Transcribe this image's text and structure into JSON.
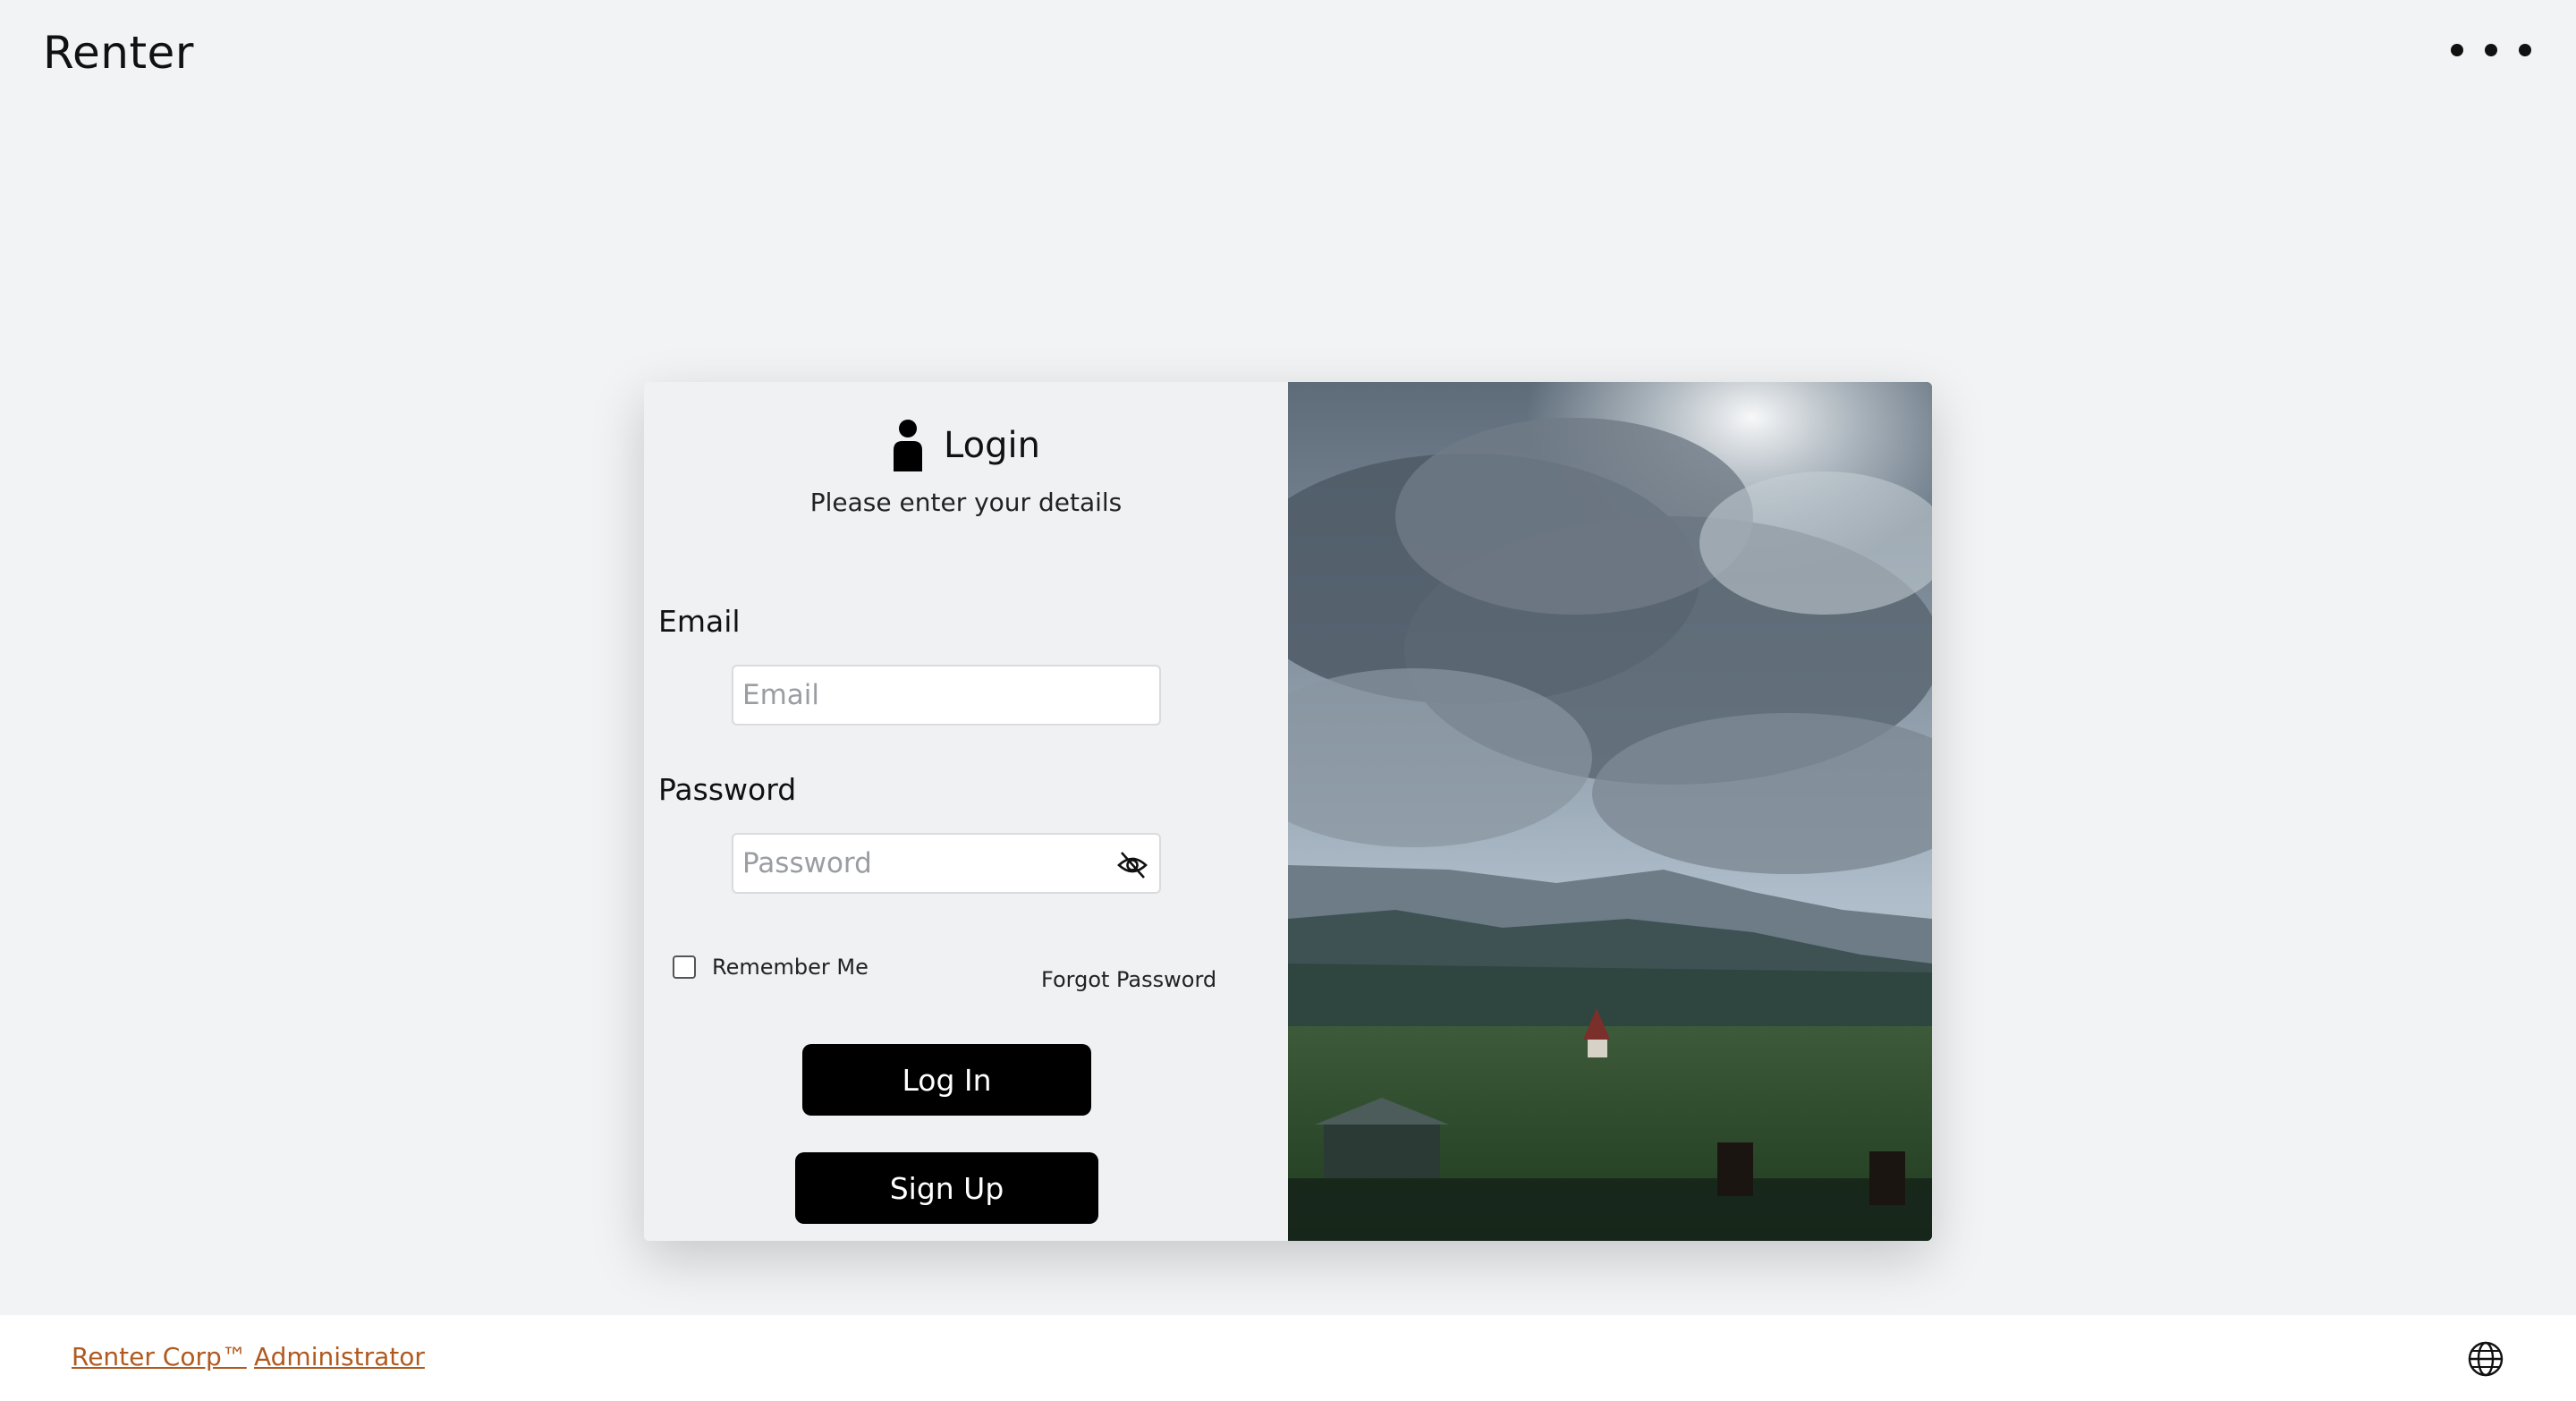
{
  "header": {
    "app_title": "Renter",
    "more_icon": "more-horizontal-icon"
  },
  "login": {
    "title": "Login",
    "subtitle": "Please enter your details",
    "user_icon": "user-icon",
    "email": {
      "label": "Email",
      "placeholder": "Email",
      "value": ""
    },
    "password": {
      "label": "Password",
      "placeholder": "Password",
      "value": "",
      "toggle_icon": "eye-off-icon"
    },
    "remember_label": "Remember Me",
    "remember_checked": false,
    "forgot_label": "Forgot Password",
    "login_button": "Log In",
    "signup_button": "Sign Up"
  },
  "image_panel": {
    "description_icon": "landscape-photo"
  },
  "footer": {
    "links": [
      "Renter Corp™",
      "Administrator"
    ],
    "globe_icon": "globe-icon"
  },
  "colors": {
    "background": "#f2f3f5",
    "button": "#000000",
    "link": "#b05a1f"
  }
}
